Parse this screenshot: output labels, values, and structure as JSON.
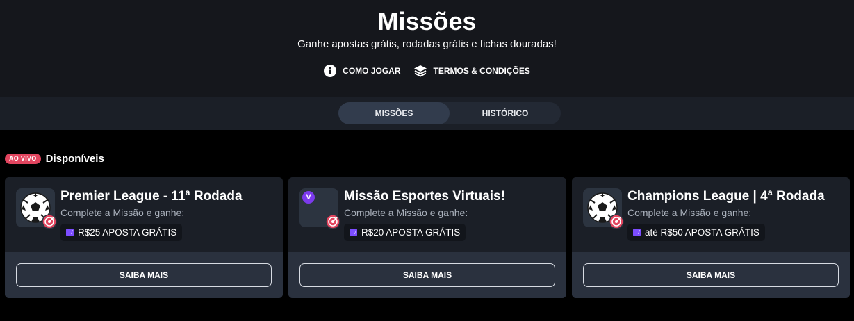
{
  "header": {
    "title": "Missões",
    "subtitle": "Ganhe apostas grátis, rodadas grátis e fichas douradas!",
    "links": [
      {
        "label": "COMO JOGAR",
        "icon": "info-icon"
      },
      {
        "label": "TERMOS & CONDIÇÕES",
        "icon": "layers-icon"
      }
    ]
  },
  "tabs": [
    {
      "label": "MISSÕES",
      "active": true
    },
    {
      "label": "HISTÓRICO",
      "active": false
    }
  ],
  "section": {
    "badge": "AO VIVO",
    "title": "Disponíveis"
  },
  "missions": [
    {
      "title": "Premier League - 11ª Rodada",
      "description": "Complete a Missão e ganhe:",
      "reward": "R$25 APOSTA GRÁTIS",
      "thumbnail_icon": "soccer-ball-icon",
      "button_label": "SAIBA MAIS"
    },
    {
      "title": "Missão Esportes Virtuais!",
      "description": "Complete a Missão e ganhe:",
      "reward": "R$20 APOSTA GRÁTIS",
      "thumbnail_icon": "virtual-sports-icon",
      "thumbnail_letter": "V",
      "button_label": "SAIBA MAIS"
    },
    {
      "title": "Champions League | 4ª Rodada",
      "description": "Complete a Missão e ganhe:",
      "reward": "até R$50 APOSTA GRÁTIS",
      "thumbnail_icon": "soccer-ball-icon",
      "button_label": "SAIBA MAIS"
    }
  ],
  "colors": {
    "live_badge": "#e2455f",
    "accent_purple": "#7c3aed",
    "target_red": "#e2455f"
  }
}
